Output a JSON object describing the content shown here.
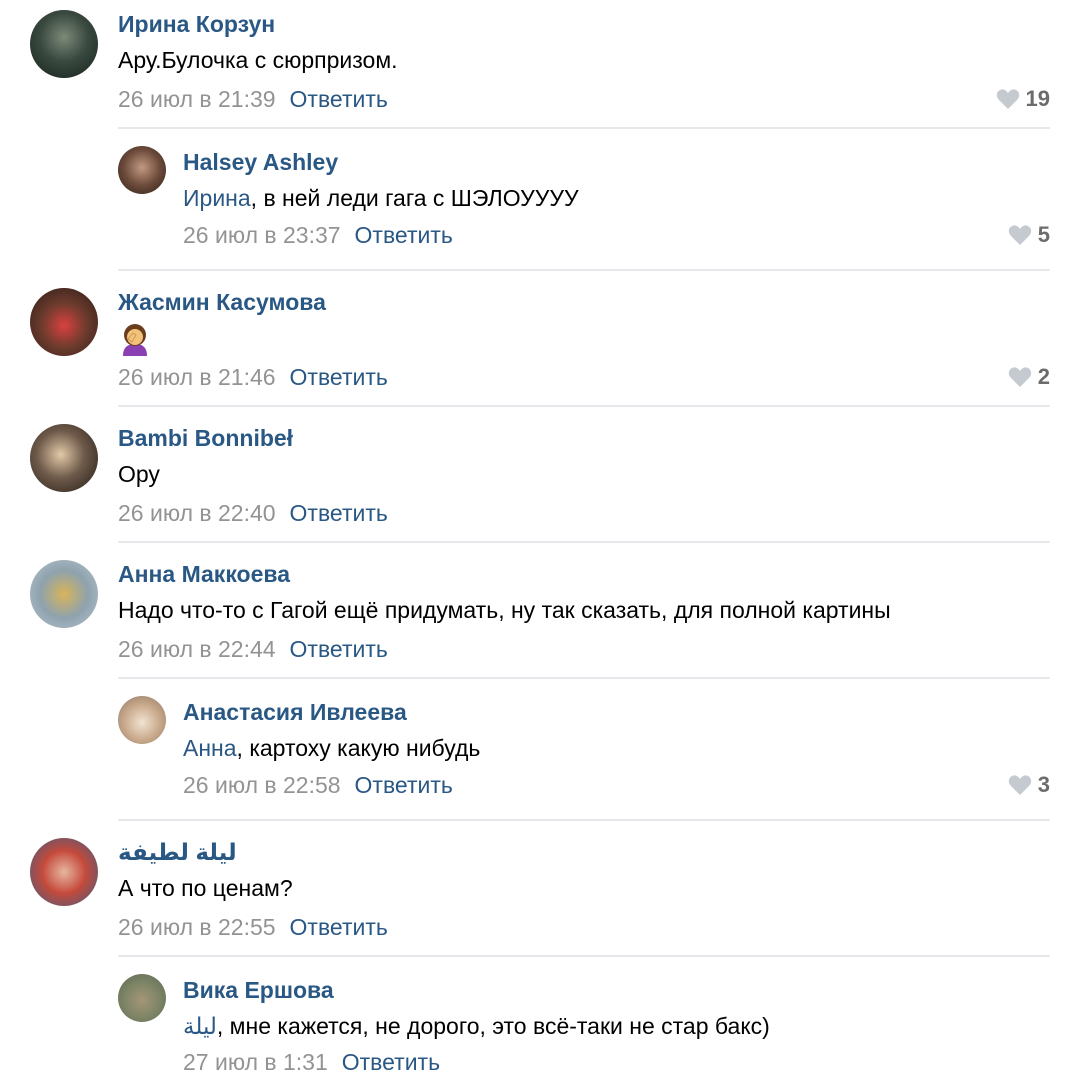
{
  "comments": [
    {
      "author": "Ирина Корзун",
      "text": "Ару.Булочка с сюрпризом.",
      "date": "26 июл в 21:39",
      "reply_label": "Ответить",
      "likes": "19"
    },
    {
      "author": "Halsey Ashley",
      "mention": "Ирина",
      "text": ", в ней леди гага с ШЭЛОУУУУ",
      "date": "26 июл в 23:37",
      "reply_label": "Ответить",
      "likes": "5"
    },
    {
      "author": "Жасмин Касумова",
      "text_emoji": "woman-facepalming-emoji",
      "date": "26 июл в 21:46",
      "reply_label": "Ответить",
      "likes": "2"
    },
    {
      "author": "Bambi Bonnibeł",
      "text": "Ору",
      "date": "26 июл в 22:40",
      "reply_label": "Ответить"
    },
    {
      "author": "Анна Маккоева",
      "text": "Надо что-то с Гагой ещё придумать, ну так сказать, для полной картины",
      "date": "26 июл в 22:44",
      "reply_label": "Ответить"
    },
    {
      "author": "Анастасия Ивлеева",
      "mention": "Анна",
      "text": ", картоху какую нибудь",
      "date": "26 июл в 22:58",
      "reply_label": "Ответить",
      "likes": "3"
    },
    {
      "author": "ليلة لطيفة",
      "text": "А что по ценам?",
      "date": "26 июл в 22:55",
      "reply_label": "Ответить"
    },
    {
      "author": "Вика Ершова",
      "mention": "ليلة",
      "text": ", мне кажется, не дорого, это всё-таки не стар бакс)",
      "date": "27 июл в 1:31",
      "reply_label": "Ответить"
    }
  ],
  "colors": {
    "link": "#2a5885",
    "meta": "#939393",
    "separator": "#e7e8ec",
    "heart": "#c5c9d0"
  }
}
